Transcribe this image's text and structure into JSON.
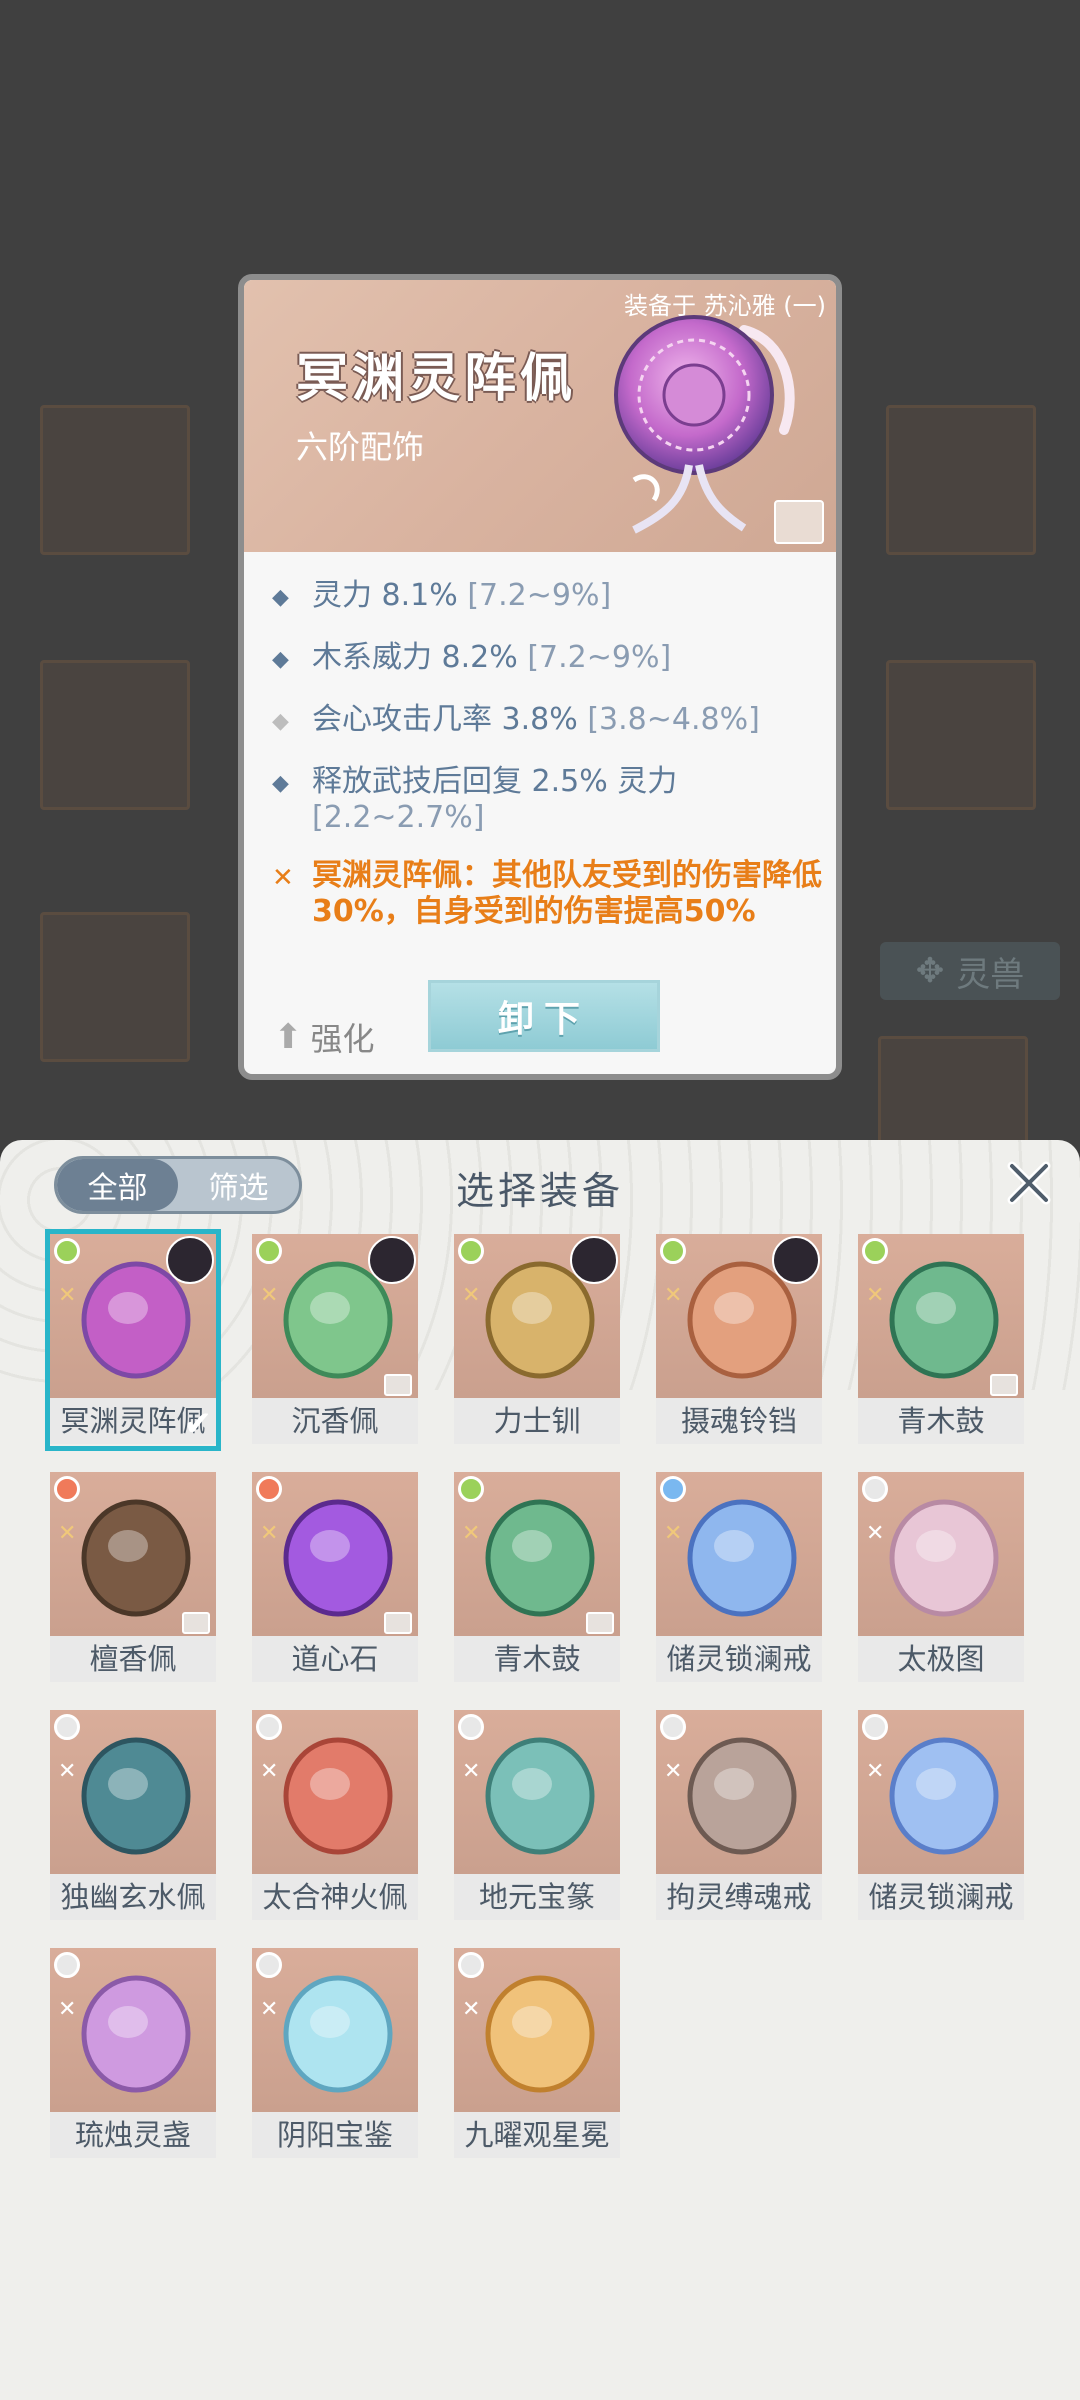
{
  "background": {
    "side_tag": "灵兽"
  },
  "tooltip": {
    "equipped_by": "装备于 苏沁雅 (一)",
    "title": "冥渊灵阵佩",
    "subtitle": "六阶配饰",
    "stats": [
      {
        "text": "灵力 8.1%",
        "range": "[7.2~9%]"
      },
      {
        "text": "木系威力 8.2%",
        "range": "[7.2~9%]"
      },
      {
        "text": "会心攻击几率 3.8%",
        "range": "[3.8~4.8%]"
      },
      {
        "text": "释放武技后回复 2.5% 灵力",
        "range": "[2.2~2.7%]"
      }
    ],
    "special": "冥渊灵阵佩：其他队友受到的伤害降低30%，自身受到的伤害提高50%",
    "upgrade_label": "强化",
    "unequip_label": "卸下"
  },
  "panel": {
    "tab_all": "全部",
    "tab_filter": "筛选",
    "title": "选择装备",
    "items": [
      {
        "name": "冥渊灵阵佩",
        "selected": true,
        "element": "wood"
      },
      {
        "name": "沉香佩",
        "element": "wood"
      },
      {
        "name": "力士钏",
        "element": "wood"
      },
      {
        "name": "摄魂铃铛",
        "element": "wood"
      },
      {
        "name": "青木鼓",
        "element": "wood"
      },
      {
        "name": "檀香佩",
        "element": "fire"
      },
      {
        "name": "道心石",
        "element": "fire"
      },
      {
        "name": "青木鼓",
        "element": "wood"
      },
      {
        "name": "储灵锁澜戒",
        "element": "water"
      },
      {
        "name": "太极图",
        "element": "neutral"
      },
      {
        "name": "独幽玄水佩",
        "element": "neutral"
      },
      {
        "name": "太合神火佩",
        "element": "neutral"
      },
      {
        "name": "地元宝篆",
        "element": "neutral"
      },
      {
        "name": "拘灵缚魂戒",
        "element": "neutral"
      },
      {
        "name": "储灵锁澜戒",
        "element": "neutral"
      },
      {
        "name": "琉烛灵盏",
        "element": "neutral"
      },
      {
        "name": "阴阳宝鉴",
        "element": "neutral"
      },
      {
        "name": "九曜观星冕",
        "element": "neutral"
      }
    ]
  },
  "colors": {
    "selected_border": "#29b5c9",
    "special_text": "#e87e18",
    "stat_text": "#5e7a98"
  }
}
